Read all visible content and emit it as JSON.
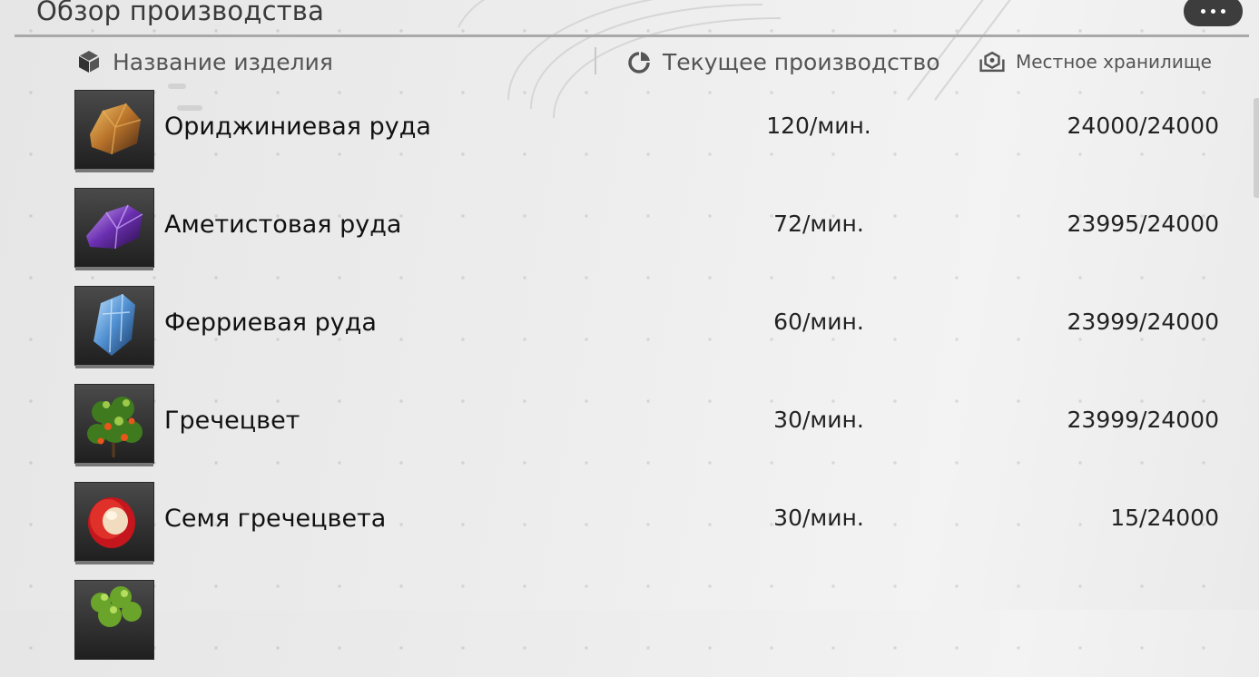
{
  "panel": {
    "title": "Обзор производства",
    "more_icon": "ellipsis-icon"
  },
  "columns": {
    "name": {
      "label": "Название изделия",
      "icon": "cube-icon"
    },
    "production": {
      "label": "Текущее производство",
      "icon": "pie-chart-icon"
    },
    "storage": {
      "label": "Местное хранилище",
      "icon": "storage-icon"
    }
  },
  "items": [
    {
      "name": "Ориджиниевая руда",
      "rate": "120/мин.",
      "storage": "24000/24000",
      "icon": "orange-ore-icon"
    },
    {
      "name": "Аметистовая руда",
      "rate": "72/мин.",
      "storage": "23995/24000",
      "icon": "amethyst-ore-icon"
    },
    {
      "name": "Ферриевая руда",
      "rate": "60/мин.",
      "storage": "23999/24000",
      "icon": "blue-crystal-icon"
    },
    {
      "name": "Гречецвет",
      "rate": "30/мин.",
      "storage": "23999/24000",
      "icon": "berry-bush-icon"
    },
    {
      "name": "Семя гречецвета",
      "rate": "30/мин.",
      "storage": "15/24000",
      "icon": "seed-icon"
    },
    {
      "name": "",
      "rate": "",
      "storage": "",
      "icon": "green-plant-icon"
    }
  ]
}
